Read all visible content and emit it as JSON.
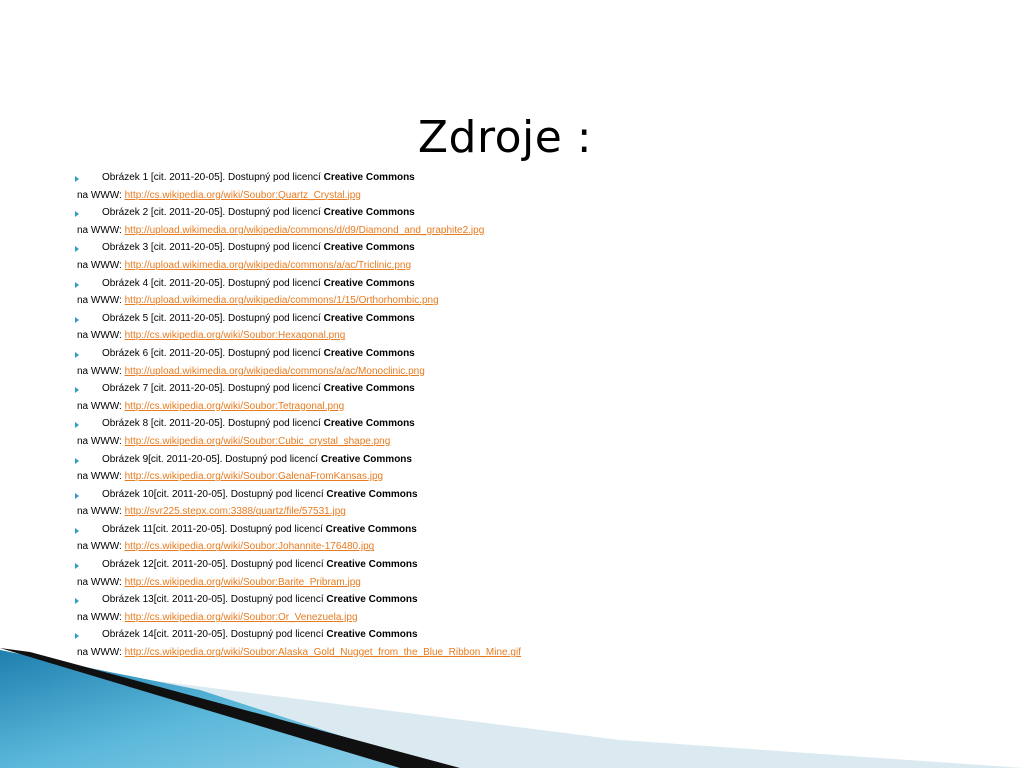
{
  "slide": {
    "title": "Zdroje :"
  },
  "sources": [
    {
      "caption": "Obrázek 1 [cit. 2011-20-05]. Dostupný pod licencí",
      "license": "Creative Commons",
      "www_label": "na WWW:",
      "url": "http://cs.wikipedia.org/wiki/Soubor:Quartz_Crystal.jpg"
    },
    {
      "caption": "Obrázek 2 [cit. 2011-20-05]. Dostupný pod licencí",
      "license": "Creative Commons",
      "www_label": "na WWW:",
      "url": "http://upload.wikimedia.org/wikipedia/commons/d/d9/Diamond_and_graphite2.jpg"
    },
    {
      "caption": "Obrázek 3 [cit. 2011-20-05]. Dostupný pod licencí",
      "license": "Creative Commons",
      "www_label": "na WWW:",
      "url": "http://upload.wikimedia.org/wikipedia/commons/a/ac/Triclinic.png"
    },
    {
      "caption": "Obrázek 4 [cit. 2011-20-05]. Dostupný pod licencí",
      "license": "Creative Commons",
      "www_label": "na WWW:",
      "url": "http://upload.wikimedia.org/wikipedia/commons/1/15/Orthorhombic.png"
    },
    {
      "caption": "Obrázek 5 [cit. 2011-20-05]. Dostupný pod licencí",
      "license": "Creative Commons",
      "www_label": "na WWW:",
      "url": "http://cs.wikipedia.org/wiki/Soubor:Hexagonal.png"
    },
    {
      "caption": "Obrázek 6 [cit. 2011-20-05]. Dostupný pod licencí",
      "license": "Creative Commons",
      "www_label": "na WWW:",
      "url": "http://upload.wikimedia.org/wikipedia/commons/a/ac/Monoclinic.png"
    },
    {
      "caption": "Obrázek 7 [cit. 2011-20-05]. Dostupný pod licencí",
      "license": "Creative Commons",
      "www_label": "na WWW:",
      "url": "http://cs.wikipedia.org/wiki/Soubor:Tetragonal.png"
    },
    {
      "caption": "Obrázek 8 [cit. 2011-20-05]. Dostupný pod licencí",
      "license": "Creative Commons",
      "www_label": "na WWW:",
      "url": "http://cs.wikipedia.org/wiki/Soubor:Cubic_crystal_shape.png"
    },
    {
      "caption": "Obrázek 9[cit. 2011-20-05]. Dostupný pod licencí",
      "license": "Creative Commons",
      "www_label": "na WWW:",
      "url": "http://cs.wikipedia.org/wiki/Soubor:GalenaFromKansas.jpg"
    },
    {
      "caption": "Obrázek 10[cit. 2011-20-05]. Dostupný pod licencí",
      "license": "Creative Commons",
      "www_label": "na WWW:",
      "url": "http://svr225.stepx.com:3388/quartz/file/57531.jpg"
    },
    {
      "caption": "Obrázek 11[cit. 2011-20-05]. Dostupný pod licencí",
      "license": "Creative Commons",
      "www_label": "na WWW:",
      "url": "http://cs.wikipedia.org/wiki/Soubor:Johannite-176480.jpg"
    },
    {
      "caption": "Obrázek 12[cit. 2011-20-05]. Dostupný pod licencí",
      "license": "Creative Commons",
      "www_label": "na WWW:",
      "url": "http://cs.wikipedia.org/wiki/Soubor:Barite_Pribram.jpg"
    },
    {
      "caption": "Obrázek 13[cit. 2011-20-05]. Dostupný pod licencí",
      "license": "Creative Commons",
      "www_label": "na WWW:",
      "url": "http://cs.wikipedia.org/wiki/Soubor:Or_Venezuela.jpg"
    },
    {
      "caption": "Obrázek 14[cit. 2011-20-05]. Dostupný pod licencí",
      "license": "Creative Commons",
      "www_label": "na WWW:",
      "url": "http://cs.wikipedia.org/wiki/Soubor:Alaska_Gold_Nugget_from_the_Blue_Ribbon_Mine.gif"
    }
  ],
  "colors": {
    "link": "#e87b1f",
    "bullet": "#2e9ec9",
    "accent_dark": "#111111",
    "accent_blue": "#5ab4d6",
    "accent_light": "#d8eaf2"
  },
  "icons": {
    "bullet": "triangle-bullet-icon"
  }
}
